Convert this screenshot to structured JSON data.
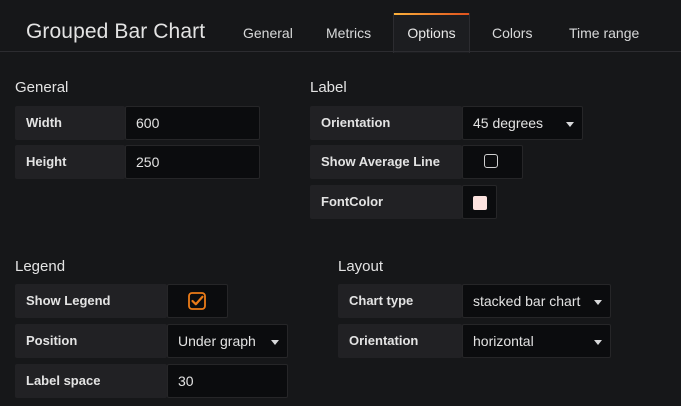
{
  "header": {
    "title": "Grouped Bar Chart",
    "tabs": [
      "General",
      "Metrics",
      "Options",
      "Colors",
      "Time range"
    ],
    "active_tab": "Options"
  },
  "general": {
    "heading": "General",
    "width_label": "Width",
    "width_value": "600",
    "height_label": "Height",
    "height_value": "250"
  },
  "label": {
    "heading": "Label",
    "orientation_label": "Orientation",
    "orientation_value": "45 degrees",
    "avg_line_label": "Show Average Line",
    "avg_line_checked": false,
    "font_color_label": "FontColor",
    "font_color": "#fce2de"
  },
  "legend": {
    "heading": "Legend",
    "show_label": "Show Legend",
    "show_checked": true,
    "position_label": "Position",
    "position_value": "Under graph",
    "space_label": "Label space",
    "space_value": "30"
  },
  "layout": {
    "heading": "Layout",
    "chart_type_label": "Chart type",
    "chart_type_value": "stacked bar chart",
    "orientation_label": "Orientation",
    "orientation_value": "horizontal"
  },
  "colors": {
    "accent": "#eb7b18",
    "background": "#161719",
    "label_bg": "#212124",
    "input_bg": "#0b0c0e"
  }
}
